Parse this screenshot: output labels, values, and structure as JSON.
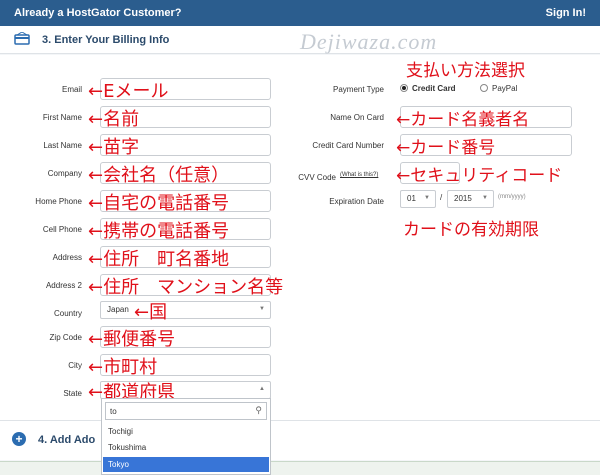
{
  "header": {
    "title": "Already a HostGator Customer?",
    "signin": "Sign In!"
  },
  "watermark": "Dejiwaza.com",
  "section3": {
    "title": "3. Enter Your Billing Info"
  },
  "section4": {
    "title": "4. Add Ado"
  },
  "left_fields": [
    {
      "label": "Email",
      "note": "←Eメール"
    },
    {
      "label": "First Name",
      "note": "←名前"
    },
    {
      "label": "Last Name",
      "note": "←苗字"
    },
    {
      "label": "Company",
      "note": "←会社名（任意）"
    },
    {
      "label": "Home Phone",
      "note": "←自宅の電話番号"
    },
    {
      "label": "Cell Phone",
      "note": "←携帯の電話番号"
    },
    {
      "label": "Address",
      "note": "←住所　町名番地"
    },
    {
      "label": "Address 2",
      "note": "←住所　マンション名等"
    },
    {
      "label": "Country",
      "note": "←国",
      "value": "Japan"
    },
    {
      "label": "Zip Code",
      "note": "←郵便番号"
    },
    {
      "label": "City",
      "note": "←市町村"
    },
    {
      "label": "State",
      "note": "←都道府県"
    }
  ],
  "right": {
    "payment_type": "Payment Type",
    "payment_note": "支払い方法選択",
    "credit_card": "Credit Card",
    "paypal": "PayPal",
    "name_on_card": "Name On Card",
    "name_note": "←カード名義者名",
    "card_number": "Credit Card Number",
    "card_note": "←カード番号",
    "cvv": "CVV Code",
    "cvv_link": "(What is this?)",
    "cvv_note": "←セキュリティコード",
    "expiration": "Expiration Date",
    "exp_month": "01",
    "exp_sep": "/",
    "exp_year": "2015",
    "exp_hint": "(mm/yyyy)",
    "exp_note": "カードの有効期限"
  },
  "dropdown": {
    "search": "to",
    "options": [
      "Tochigi",
      "Tokushima",
      "Tokyo"
    ]
  }
}
